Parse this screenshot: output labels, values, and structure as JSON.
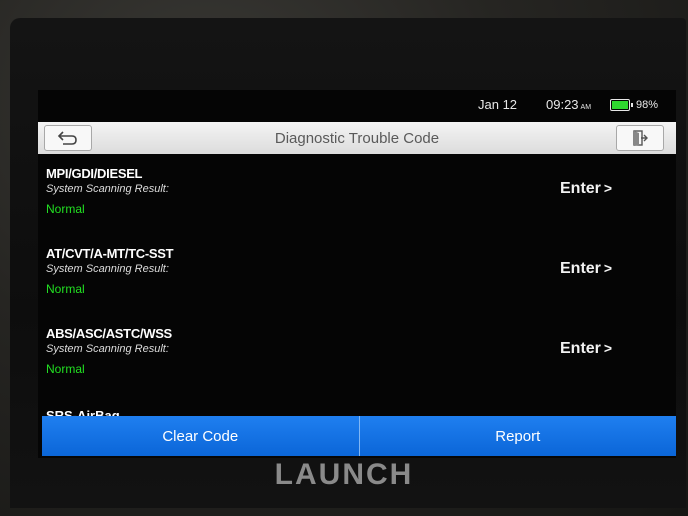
{
  "status_bar": {
    "date": "Jan 12",
    "time": "09:23",
    "ampm": "AM",
    "battery_percent_text": "98%",
    "battery_level": 0.98
  },
  "header": {
    "title": "Diagnostic Trouble Code",
    "back_icon": "back-arrow-icon",
    "exit_icon": "exit-door-icon"
  },
  "systems": [
    {
      "name": "MPI/GDI/DIESEL",
      "subtitle": "System Scanning Result:",
      "status": "Normal",
      "action": "Enter"
    },
    {
      "name": "AT/CVT/A-MT/TC-SST",
      "subtitle": "System Scanning Result:",
      "status": "Normal",
      "action": "Enter"
    },
    {
      "name": "ABS/ASC/ASTC/WSS",
      "subtitle": "System Scanning Result:",
      "status": "Normal",
      "action": "Enter"
    }
  ],
  "partial_item": "SRS-AirBag",
  "footer": {
    "clear_code": "Clear Code",
    "report": "Report"
  },
  "brand": "LAUNCH",
  "colors": {
    "status_ok": "#22e022",
    "footer_blue": "#1177ea",
    "title_bar": "#e8e8e8"
  }
}
